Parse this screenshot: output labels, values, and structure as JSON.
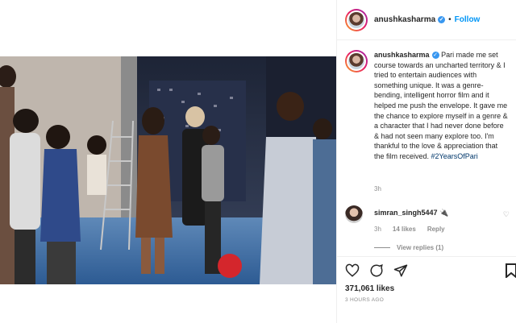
{
  "post": {
    "username": "anushkasharma",
    "verified_mark": "✓",
    "follow_label": "Follow",
    "dot": "•",
    "caption_user": "anushkasharma",
    "caption_text": "Pari made me set course towards an uncharted territory & I tried to entertain audiences with something unique. It was a genre-bending, intelligent horror film and it helped me push the envelope. It gave me the chance to explore myself in a genre & a character that I had never done before & had not seen many explore too. I'm thankful to the love & appreciation that the film received.",
    "hashtag": "#2YearsOfPari",
    "caption_age": "3h",
    "likes": "371,061 likes",
    "time_ago": "3 HOURS AGO"
  },
  "comment": {
    "username": "simran_singh5447",
    "emoji": "🔌",
    "age": "3h",
    "likes": "14 likes",
    "reply_label": "Reply",
    "view_replies": "View replies (1)"
  },
  "icons": {
    "like": "heart-icon",
    "comment": "comment-icon",
    "share": "share-icon",
    "save": "bookmark-icon",
    "comment_like": "small-heart-icon"
  },
  "colors": {
    "link_blue": "#0095f6",
    "text": "#262626",
    "muted": "#8e8e8e",
    "hashtag": "#00376b"
  }
}
